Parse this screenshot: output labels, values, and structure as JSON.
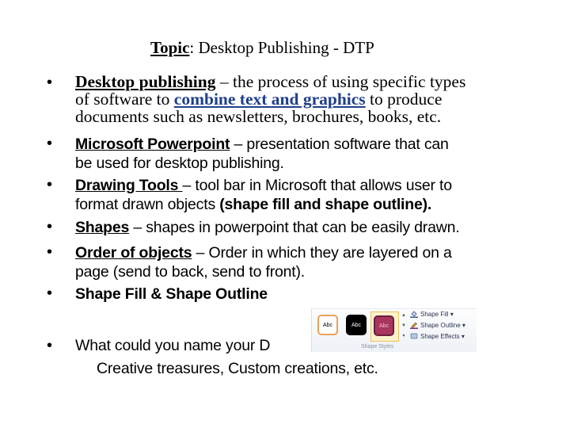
{
  "title": {
    "topic_label": "Topic",
    "rest": ": Desktop Publishing - DTP"
  },
  "bullet_glyph": "•",
  "items": [
    {
      "term": "Desktop publishing",
      "line1_rest": " – the process of using specific types",
      "line2_pre": "of software to ",
      "line2_link": "combine text and graphics",
      "line2_post": " to produce",
      "line3": "documents such as newsletters, brochures, books, etc."
    },
    {
      "term": "Microsoft Powerpoint",
      "line1_rest": " – presentation software that can",
      "line2": "be used for desktop publishing."
    },
    {
      "term": "Drawing Tools ",
      "line1_rest": "– tool bar in Microsoft that allows user to",
      "line2_pre": "format drawn objects ",
      "line2_bold": "(shape fill and shape outline)."
    },
    {
      "term": "Shapes",
      "line1_rest": " – shapes in powerpoint that can be easily drawn."
    },
    {
      "term": "Order of objects",
      "line1_rest": " – Order in which they are layered on a",
      "line2": "page (send to back, send to front)."
    },
    {
      "bold_text": "Shape Fill & Shape Outline"
    },
    {
      "question": "What could you name your D",
      "answer": "Creative treasures, Custom creations, etc."
    }
  ],
  "ribbon": {
    "swatch_label": "Abc",
    "commands": [
      {
        "label": "Shape Fill ▾",
        "icon": "paint-bucket-icon"
      },
      {
        "label": "Shape Outline ▾",
        "icon": "pencil-outline-icon"
      },
      {
        "label": "Shape Effects ▾",
        "icon": "shape-effects-icon"
      }
    ],
    "group_label": "Shape Styles",
    "scroll_up": "▲",
    "scroll_down": "▼",
    "more": "▾"
  }
}
